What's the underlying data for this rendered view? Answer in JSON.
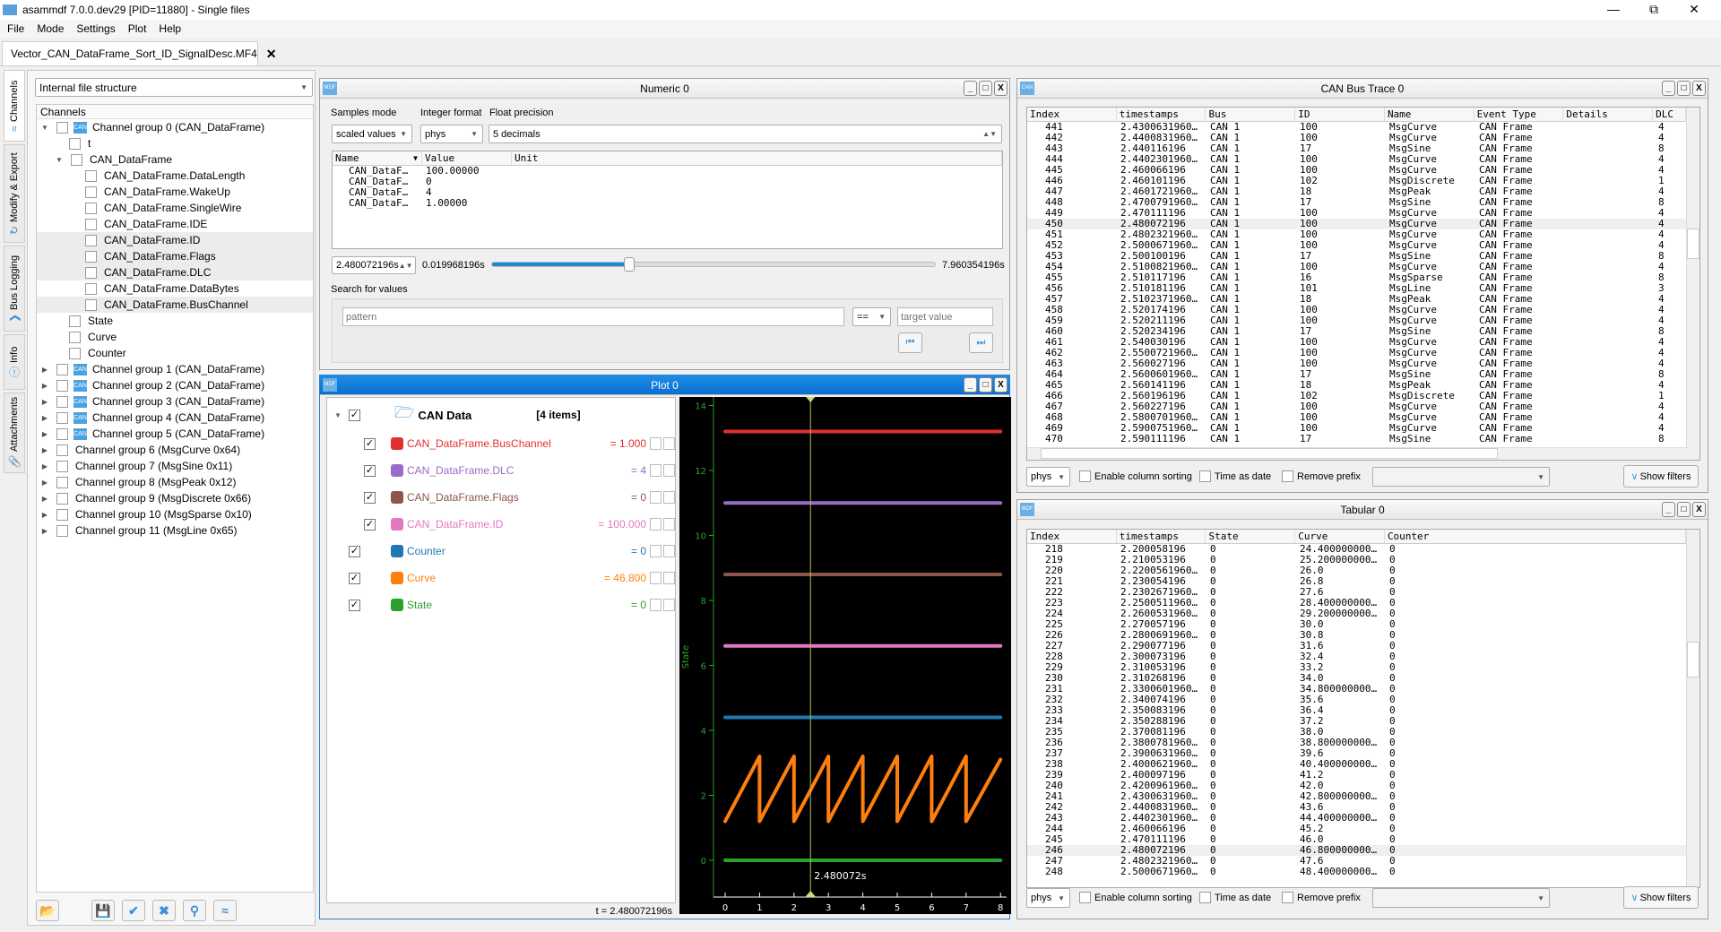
{
  "app": {
    "title": "asammdf 7.0.0.dev29 [PID=11880] - Single files",
    "logo": "MDF"
  },
  "menu": [
    "File",
    "Mode",
    "Settings",
    "Plot",
    "Help"
  ],
  "file_tab": {
    "label": "Vector_CAN_DataFrame_Sort_ID_SignalDesc.MF4"
  },
  "side_tabs": [
    {
      "label": "Channels",
      "icon": "channels-icon"
    },
    {
      "label": "Modify & Export",
      "icon": "refresh-icon"
    },
    {
      "label": "Bus Logging",
      "icon": "chevron-icon"
    },
    {
      "label": "Info",
      "icon": "info-icon"
    },
    {
      "label": "Attachments",
      "icon": "paperclip-icon"
    }
  ],
  "channels_panel": {
    "view_mode": "Internal file structure",
    "header": "Channels",
    "tree": [
      {
        "label": "Channel group 0 (CAN_DataFrame)",
        "level": 0,
        "expander": "open",
        "can": true
      },
      {
        "label": "t",
        "level": 1
      },
      {
        "label": "CAN_DataFrame",
        "level": 1,
        "expander": "open"
      },
      {
        "label": "CAN_DataFrame.DataLength",
        "level": 2
      },
      {
        "label": "CAN_DataFrame.WakeUp",
        "level": 2
      },
      {
        "label": "CAN_DataFrame.SingleWire",
        "level": 2
      },
      {
        "label": "CAN_DataFrame.IDE",
        "level": 2
      },
      {
        "label": "CAN_DataFrame.ID",
        "level": 2,
        "highlighted": true
      },
      {
        "label": "CAN_DataFrame.Flags",
        "level": 2,
        "highlighted": true
      },
      {
        "label": "CAN_DataFrame.DLC",
        "level": 2,
        "highlighted": true
      },
      {
        "label": "CAN_DataFrame.DataBytes",
        "level": 2
      },
      {
        "label": "CAN_DataFrame.BusChannel",
        "level": 2,
        "highlighted": true
      },
      {
        "label": "State",
        "level": 1
      },
      {
        "label": "Curve",
        "level": 1
      },
      {
        "label": "Counter",
        "level": 1
      },
      {
        "label": "Channel group 1 (CAN_DataFrame)",
        "level": 0,
        "expander": "closed",
        "can": true
      },
      {
        "label": "Channel group 2 (CAN_DataFrame)",
        "level": 0,
        "expander": "closed",
        "can": true
      },
      {
        "label": "Channel group 3 (CAN_DataFrame)",
        "level": 0,
        "expander": "closed",
        "can": true
      },
      {
        "label": "Channel group 4 (CAN_DataFrame)",
        "level": 0,
        "expander": "closed",
        "can": true
      },
      {
        "label": "Channel group 5 (CAN_DataFrame)",
        "level": 0,
        "expander": "closed",
        "can": true
      },
      {
        "label": "Channel group 6 (MsgCurve 0x64)",
        "level": 0,
        "expander": "closed"
      },
      {
        "label": "Channel group 7 (MsgSine 0x11)",
        "level": 0,
        "expander": "closed"
      },
      {
        "label": "Channel group 8 (MsgPeak 0x12)",
        "level": 0,
        "expander": "closed"
      },
      {
        "label": "Channel group 9 (MsgDiscrete 0x66)",
        "level": 0,
        "expander": "closed"
      },
      {
        "label": "Channel group 10 (MsgSparse 0x10)",
        "level": 0,
        "expander": "closed"
      },
      {
        "label": "Channel group 11 (MsgLine 0x65)",
        "level": 0,
        "expander": "closed"
      }
    ],
    "tool_icons": [
      "folder-open-icon",
      "save-icon",
      "check-icon",
      "cross-icon",
      "search-icon",
      "plot-icon"
    ]
  },
  "numeric": {
    "title": "Numeric 0",
    "samples_mode_label": "Samples mode",
    "integer_format_label": "Integer format",
    "float_precision_label": "Float precision",
    "samples_mode": "scaled values",
    "integer_format": "phys",
    "float_precision": "5 decimals",
    "columns": [
      "Name",
      "Value",
      "Unit"
    ],
    "rows": [
      [
        "CAN_DataF…",
        "100.00000",
        ""
      ],
      [
        "CAN_DataF…",
        "0",
        ""
      ],
      [
        "CAN_DataF…",
        "4",
        ""
      ],
      [
        "CAN_DataF…",
        "1.00000",
        ""
      ]
    ],
    "timestamp": "2.480072196s",
    "min_time": "0.019968196s",
    "max_time": "7.960354196s",
    "slider_fraction": 0.31,
    "search_label": "Search for values",
    "pattern_placeholder": "pattern",
    "operator": "==",
    "target_placeholder": "target value"
  },
  "plot": {
    "title": "Plot 0",
    "group": {
      "label": "CAN Data",
      "count": "[4 items]"
    },
    "legend": [
      {
        "name": "CAN_DataFrame.BusChannel",
        "value": "= 1.000",
        "color": "#e03030",
        "indent": true
      },
      {
        "name": "CAN_DataFrame.DLC",
        "value": "= 4",
        "color": "#9a6cc8",
        "indent": true
      },
      {
        "name": "CAN_DataFrame.Flags",
        "value": "= 0",
        "color": "#8c564b",
        "indent": true
      },
      {
        "name": "CAN_DataFrame.ID",
        "value": "= 100.000",
        "color": "#e377c2",
        "indent": true
      },
      {
        "name": "Counter",
        "value": "= 0",
        "color": "#1f77b4",
        "indent": false
      },
      {
        "name": "Curve",
        "value": "= 46.800",
        "color": "#ff7f0e",
        "indent": false
      },
      {
        "name": "State",
        "value": "= 0",
        "color": "#2ca02c",
        "indent": false
      }
    ],
    "status": "t = 2.480072196s",
    "chart": {
      "ylabel": "State",
      "xlim": [
        -0.2,
        8.3
      ],
      "ylim": [
        -1,
        14.3
      ],
      "yticks": [
        0,
        2,
        4,
        6,
        8,
        10,
        12,
        14
      ],
      "xticks": [
        0,
        1,
        2,
        3,
        4,
        5,
        6,
        7,
        8
      ],
      "cursor": 2.48,
      "cursor_label": "2.480072s",
      "axis_color": "#2ca02c",
      "series": [
        {
          "color": "#e03030",
          "points": [
            [
              0,
              13.2
            ],
            [
              8,
              13.2
            ]
          ]
        },
        {
          "color": "#9a6cc8",
          "points": [
            [
              0,
              11.0
            ],
            [
              8,
              11.0
            ]
          ]
        },
        {
          "color": "#8c564b",
          "points": [
            [
              0,
              8.8
            ],
            [
              8,
              8.8
            ]
          ]
        },
        {
          "color": "#e377c2",
          "points": [
            [
              0,
              6.6
            ],
            [
              8,
              6.6
            ]
          ]
        },
        {
          "color": "#1f77b4",
          "points": [
            [
              0,
              4.4
            ],
            [
              8,
              4.4
            ]
          ]
        },
        {
          "color": "#ff7f0e",
          "points": [
            [
              0,
              1.2
            ],
            [
              1,
              3.2
            ],
            [
              1,
              1.2
            ],
            [
              2,
              3.2
            ],
            [
              2,
              1.2
            ],
            [
              3,
              3.2
            ],
            [
              3,
              1.2
            ],
            [
              4,
              3.2
            ],
            [
              4,
              1.2
            ],
            [
              5,
              3.2
            ],
            [
              5,
              1.2
            ],
            [
              6,
              3.2
            ],
            [
              6,
              1.2
            ],
            [
              7,
              3.2
            ],
            [
              7,
              1.2
            ],
            [
              8,
              3.1
            ]
          ]
        },
        {
          "color": "#2ca02c",
          "points": [
            [
              0,
              0
            ],
            [
              8,
              0
            ]
          ]
        }
      ]
    }
  },
  "trace": {
    "title": "CAN Bus Trace 0",
    "columns": [
      "Index",
      "timestamps",
      "Bus",
      "ID",
      "Name",
      "Event Type",
      "Details",
      "DLC"
    ],
    "selected_index": "450",
    "rows": [
      [
        "441",
        "2.4300631960…",
        "CAN 1",
        "100",
        "MsgCurve",
        "CAN Frame",
        "",
        "4"
      ],
      [
        "442",
        "2.4400831960…",
        "CAN 1",
        "100",
        "MsgCurve",
        "CAN Frame",
        "",
        "4"
      ],
      [
        "443",
        "2.440116196",
        "CAN 1",
        "17",
        "MsgSine",
        "CAN Frame",
        "",
        "8"
      ],
      [
        "444",
        "2.4402301960…",
        "CAN 1",
        "100",
        "MsgCurve",
        "CAN Frame",
        "",
        "4"
      ],
      [
        "445",
        "2.460066196",
        "CAN 1",
        "100",
        "MsgCurve",
        "CAN Frame",
        "",
        "4"
      ],
      [
        "446",
        "2.460101196",
        "CAN 1",
        "102",
        "MsgDiscrete",
        "CAN Frame",
        "",
        "1"
      ],
      [
        "447",
        "2.4601721960…",
        "CAN 1",
        "18",
        "MsgPeak",
        "CAN Frame",
        "",
        "4"
      ],
      [
        "448",
        "2.4700791960…",
        "CAN 1",
        "17",
        "MsgSine",
        "CAN Frame",
        "",
        "8"
      ],
      [
        "449",
        "2.470111196",
        "CAN 1",
        "100",
        "MsgCurve",
        "CAN Frame",
        "",
        "4"
      ],
      [
        "450",
        "2.480072196",
        "CAN 1",
        "100",
        "MsgCurve",
        "CAN Frame",
        "",
        "4"
      ],
      [
        "451",
        "2.4802321960…",
        "CAN 1",
        "100",
        "MsgCurve",
        "CAN Frame",
        "",
        "4"
      ],
      [
        "452",
        "2.5000671960…",
        "CAN 1",
        "100",
        "MsgCurve",
        "CAN Frame",
        "",
        "4"
      ],
      [
        "453",
        "2.500100196",
        "CAN 1",
        "17",
        "MsgSine",
        "CAN Frame",
        "",
        "8"
      ],
      [
        "454",
        "2.5100821960…",
        "CAN 1",
        "100",
        "MsgCurve",
        "CAN Frame",
        "",
        "4"
      ],
      [
        "455",
        "2.510117196",
        "CAN 1",
        "16",
        "MsgSparse",
        "CAN Frame",
        "",
        "8"
      ],
      [
        "456",
        "2.510181196",
        "CAN 1",
        "101",
        "MsgLine",
        "CAN Frame",
        "",
        "3"
      ],
      [
        "457",
        "2.5102371960…",
        "CAN 1",
        "18",
        "MsgPeak",
        "CAN Frame",
        "",
        "4"
      ],
      [
        "458",
        "2.520174196",
        "CAN 1",
        "100",
        "MsgCurve",
        "CAN Frame",
        "",
        "4"
      ],
      [
        "459",
        "2.520211196",
        "CAN 1",
        "100",
        "MsgCurve",
        "CAN Frame",
        "",
        "4"
      ],
      [
        "460",
        "2.520234196",
        "CAN 1",
        "17",
        "MsgSine",
        "CAN Frame",
        "",
        "8"
      ],
      [
        "461",
        "2.540030196",
        "CAN 1",
        "100",
        "MsgCurve",
        "CAN Frame",
        "",
        "4"
      ],
      [
        "462",
        "2.5500721960…",
        "CAN 1",
        "100",
        "MsgCurve",
        "CAN Frame",
        "",
        "4"
      ],
      [
        "463",
        "2.560027196",
        "CAN 1",
        "100",
        "MsgCurve",
        "CAN Frame",
        "",
        "4"
      ],
      [
        "464",
        "2.5600601960…",
        "CAN 1",
        "17",
        "MsgSine",
        "CAN Frame",
        "",
        "8"
      ],
      [
        "465",
        "2.560141196",
        "CAN 1",
        "18",
        "MsgPeak",
        "CAN Frame",
        "",
        "4"
      ],
      [
        "466",
        "2.560196196",
        "CAN 1",
        "102",
        "MsgDiscrete",
        "CAN Frame",
        "",
        "1"
      ],
      [
        "467",
        "2.560227196",
        "CAN 1",
        "100",
        "MsgCurve",
        "CAN Frame",
        "",
        "4"
      ],
      [
        "468",
        "2.5800701960…",
        "CAN 1",
        "100",
        "MsgCurve",
        "CAN Frame",
        "",
        "4"
      ],
      [
        "469",
        "2.5900751960…",
        "CAN 1",
        "100",
        "MsgCurve",
        "CAN Frame",
        "",
        "4"
      ],
      [
        "470",
        "2.590111196",
        "CAN 1",
        "17",
        "MsgSine",
        "CAN Frame",
        "",
        "8"
      ]
    ],
    "footer": {
      "format": "phys",
      "sorting": "Enable column sorting",
      "time_as_date": "Time as date",
      "remove_prefix": "Remove prefix",
      "show_filters": "Show filters"
    }
  },
  "tabular": {
    "title": "Tabular 0",
    "columns": [
      "Index",
      "timestamps",
      "State",
      "Curve",
      "Counter"
    ],
    "selected_index": "246",
    "rows": [
      [
        "218",
        "2.200058196",
        "0",
        "24.400000000…",
        "0"
      ],
      [
        "219",
        "2.210053196",
        "0",
        "25.200000000…",
        "0"
      ],
      [
        "220",
        "2.2200561960…",
        "0",
        "26.0",
        "0"
      ],
      [
        "221",
        "2.230054196",
        "0",
        "26.8",
        "0"
      ],
      [
        "222",
        "2.2302671960…",
        "0",
        "27.6",
        "0"
      ],
      [
        "223",
        "2.2500511960…",
        "0",
        "28.400000000…",
        "0"
      ],
      [
        "224",
        "2.2600531960…",
        "0",
        "29.200000000…",
        "0"
      ],
      [
        "225",
        "2.270057196",
        "0",
        "30.0",
        "0"
      ],
      [
        "226",
        "2.2800691960…",
        "0",
        "30.8",
        "0"
      ],
      [
        "227",
        "2.290077196",
        "0",
        "31.6",
        "0"
      ],
      [
        "228",
        "2.300073196",
        "0",
        "32.4",
        "0"
      ],
      [
        "229",
        "2.310053196",
        "0",
        "33.2",
        "0"
      ],
      [
        "230",
        "2.310268196",
        "0",
        "34.0",
        "0"
      ],
      [
        "231",
        "2.3300601960…",
        "0",
        "34.800000000…",
        "0"
      ],
      [
        "232",
        "2.340074196",
        "0",
        "35.6",
        "0"
      ],
      [
        "233",
        "2.350083196",
        "0",
        "36.4",
        "0"
      ],
      [
        "234",
        "2.350288196",
        "0",
        "37.2",
        "0"
      ],
      [
        "235",
        "2.370081196",
        "0",
        "38.0",
        "0"
      ],
      [
        "236",
        "2.3800781960…",
        "0",
        "38.800000000…",
        "0"
      ],
      [
        "237",
        "2.3900631960…",
        "0",
        "39.6",
        "0"
      ],
      [
        "238",
        "2.4000621960…",
        "0",
        "40.400000000…",
        "0"
      ],
      [
        "239",
        "2.400097196",
        "0",
        "41.2",
        "0"
      ],
      [
        "240",
        "2.4200961960…",
        "0",
        "42.0",
        "0"
      ],
      [
        "241",
        "2.4300631960…",
        "0",
        "42.800000000…",
        "0"
      ],
      [
        "242",
        "2.4400831960…",
        "0",
        "43.6",
        "0"
      ],
      [
        "243",
        "2.4402301960…",
        "0",
        "44.400000000…",
        "0"
      ],
      [
        "244",
        "2.460066196",
        "0",
        "45.2",
        "0"
      ],
      [
        "245",
        "2.470111196",
        "0",
        "46.0",
        "0"
      ],
      [
        "246",
        "2.480072196",
        "0",
        "46.800000000…",
        "0"
      ],
      [
        "247",
        "2.4802321960…",
        "0",
        "47.6",
        "0"
      ],
      [
        "248",
        "2.5000671960…",
        "0",
        "48.400000000…",
        "0"
      ]
    ],
    "footer": {
      "format": "phys",
      "sorting": "Enable column sorting",
      "time_as_date": "Time as date",
      "remove_prefix": "Remove prefix",
      "show_filters": "Show filters"
    }
  }
}
